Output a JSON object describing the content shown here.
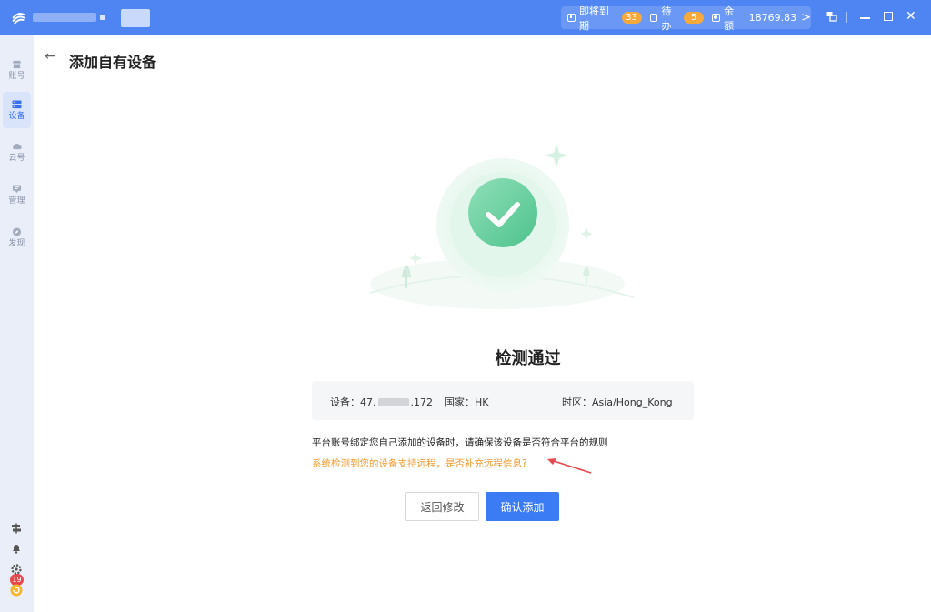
{
  "titlebar": {
    "stats": [
      {
        "label": "即将到期",
        "badge": "33"
      },
      {
        "label": "待办",
        "badge": "5"
      },
      {
        "label": "余额",
        "value": "18769.83"
      }
    ],
    "chevron": ">"
  },
  "sidebar": {
    "items": [
      {
        "label": "账号"
      },
      {
        "label": "设备"
      },
      {
        "label": "云号"
      },
      {
        "label": "管理"
      },
      {
        "label": "发现"
      }
    ],
    "notification_count": "19"
  },
  "header": {
    "back": "←",
    "title": "添加自有设备"
  },
  "result": {
    "title": "检测通过"
  },
  "device_info": {
    "device_label": "设备：",
    "device_ip_prefix": "47.",
    "device_ip_suffix": ".172",
    "country_label": "国家：",
    "country_value": "HK",
    "timezone_label": "时区：",
    "timezone_value": "Asia/Hong_Kong"
  },
  "notice": "平台账号绑定您自己添加的设备时，请确保该设备是否符合平台的规则",
  "remote_tip": "系统检测到您的设备支持远程，是否补充远程信息?",
  "buttons": {
    "back_label": "返回修改",
    "confirm_label": "确认添加"
  },
  "colors": {
    "titlebar": "#4e85f2",
    "primary": "#3b7cf5",
    "success": "#5ccb97",
    "warning_text": "#f29a2e",
    "badge": "#f7a93b",
    "arrow": "#e5484d"
  },
  "icons": {
    "app_logo": "app-logo-icon",
    "expiring": "calendar-icon",
    "todo": "checklist-icon",
    "balance": "wallet-icon",
    "success": "check-circle-icon"
  }
}
